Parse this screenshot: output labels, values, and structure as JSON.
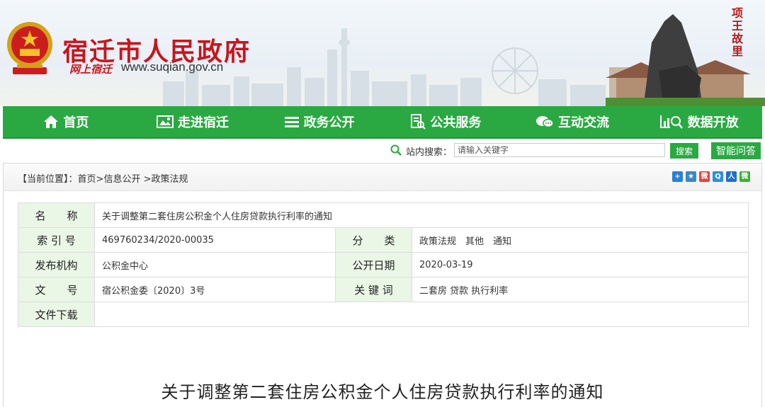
{
  "header": {
    "site_title": "宿迁市人民政府",
    "sub_logo": "网上宿迁",
    "url": "www.suqian.gov.cn",
    "seal_text": "项王故里"
  },
  "nav": {
    "items": [
      {
        "label": "首页",
        "icon": "home-icon"
      },
      {
        "label": "走进宿迁",
        "icon": "picture-icon"
      },
      {
        "label": "政务公开",
        "icon": "list-icon"
      },
      {
        "label": "公共服务",
        "icon": "service-icon"
      },
      {
        "label": "互动交流",
        "icon": "chat-icon"
      },
      {
        "label": "数据开放",
        "icon": "data-icon"
      }
    ]
  },
  "search": {
    "label": "站内搜索：",
    "placeholder": "请输入关键字",
    "button": "搜索",
    "qa_button": "智能问答"
  },
  "breadcrumb": {
    "prefix": "【当前位置】：",
    "home": "首页",
    "sep1": ">",
    "level1": "信息公开",
    "sep2": " >",
    "level2": "政策法规"
  },
  "share_icons": [
    {
      "name": "plus-share-icon",
      "color": "#2a7fd4",
      "glyph": "+"
    },
    {
      "name": "star-share-icon",
      "color": "#3a86c8",
      "glyph": "★"
    },
    {
      "name": "weibo-share-icon",
      "color": "#e0453a",
      "glyph": "微"
    },
    {
      "name": "qzone-share-icon",
      "color": "#2d8fe0",
      "glyph": "Q"
    },
    {
      "name": "renren-share-icon",
      "color": "#1f6fcf",
      "glyph": "人"
    },
    {
      "name": "wechat-share-icon",
      "color": "#3cb035",
      "glyph": "微"
    }
  ],
  "meta": {
    "name_label": "名　　称",
    "name_value": "关于调整第二套住房公积金个人住房贷款执行利率的通知",
    "index_label": "索 引 号",
    "index_value": "469760234/2020-00035",
    "category_label": "分　　类",
    "category_value": "政策法规　其他　通知",
    "issuer_label": "发布机构",
    "issuer_value": "公积金中心",
    "date_label": "公开日期",
    "date_value": "2020-03-19",
    "doc_label": "文　　号",
    "doc_value": "宿公积金委〔2020〕3号",
    "keywords_label": "关 键 词",
    "keywords_value": "二套房 贷款 执行利率",
    "download_label": "文件下载"
  },
  "article": {
    "title": "关于调整第二套住房公积金个人住房贷款执行利率的通知"
  },
  "colors": {
    "brand_red": "#c8151d",
    "nav_green": "#2aa942",
    "meta_key_bg": "#eaf6e6"
  }
}
